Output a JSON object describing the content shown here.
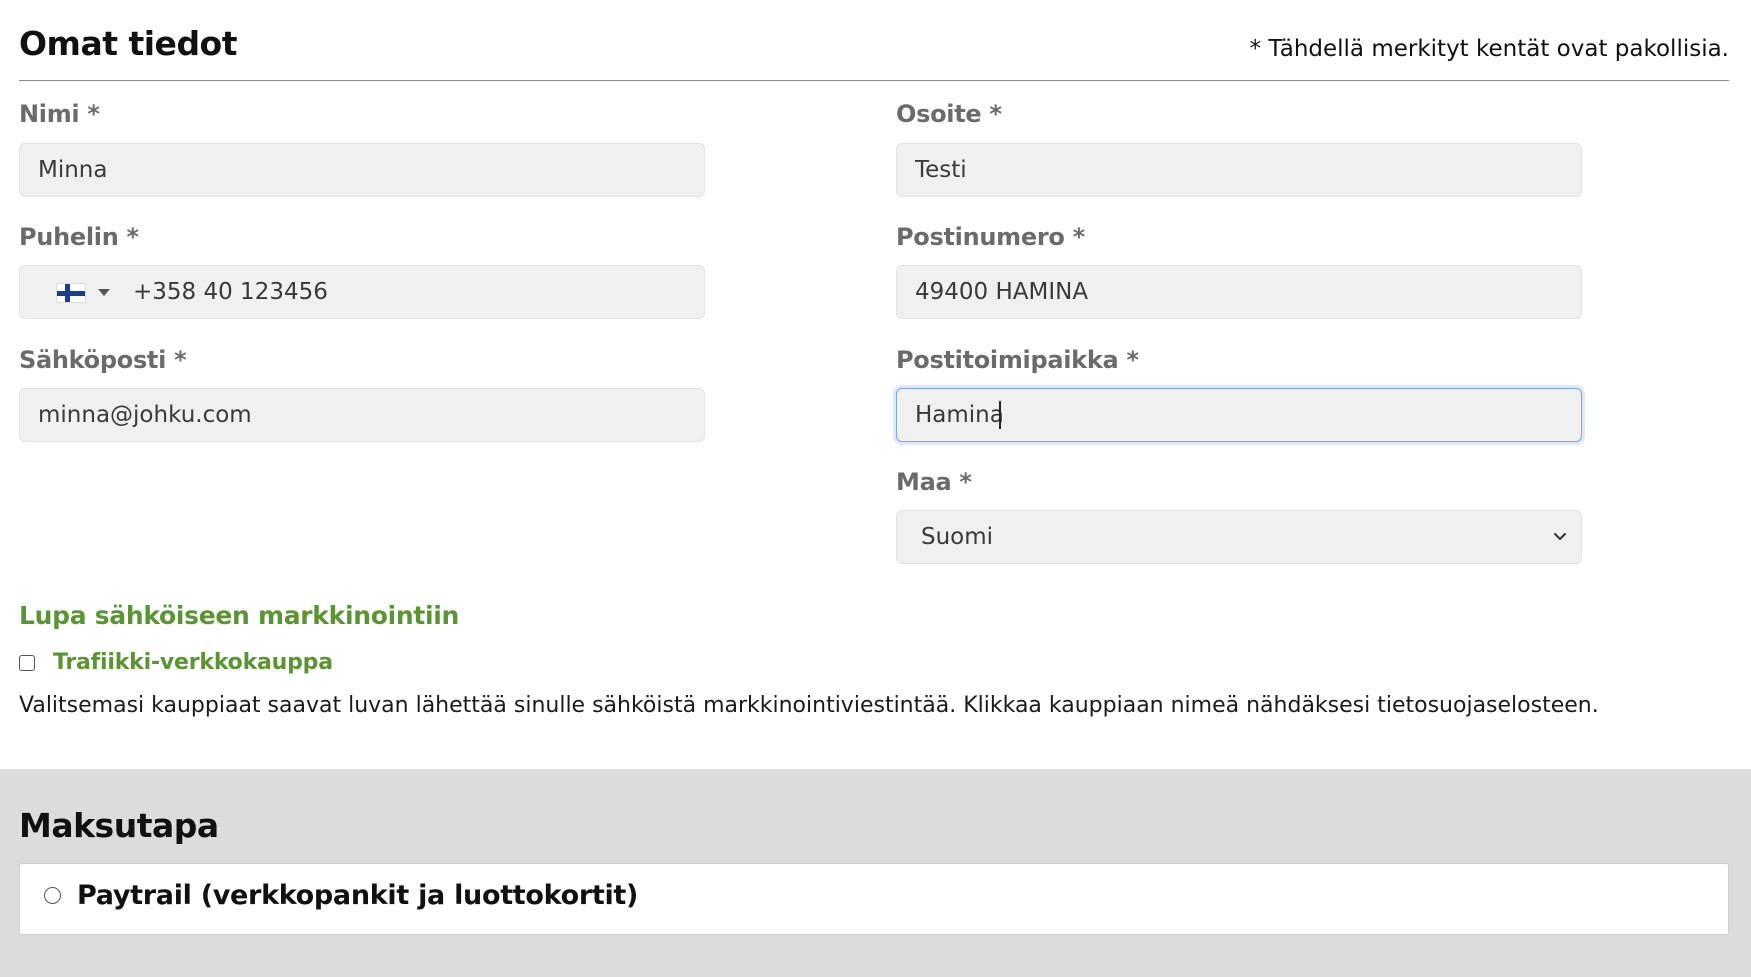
{
  "personal_info": {
    "title": "Omat tiedot",
    "required_note": "* Tähdellä merkityt kentät ovat pakollisia.",
    "fields": {
      "name": {
        "label": "Nimi *",
        "value": "Minna"
      },
      "phone": {
        "label": "Puhelin *",
        "value": "+358 40 123456",
        "country_flag": "finland-flag-icon"
      },
      "email": {
        "label": "Sähköposti *",
        "value": "minna@johku.com"
      },
      "address": {
        "label": "Osoite *",
        "value": "Testi"
      },
      "postal_code": {
        "label": "Postinumero *",
        "value": "49400 HAMINA"
      },
      "city": {
        "label": "Postitoimipaikka *",
        "value": "Hamina"
      },
      "country": {
        "label": "Maa *",
        "value": "Suomi"
      }
    }
  },
  "marketing": {
    "title": "Lupa sähköiseen markkinointiin",
    "checkbox_label": "Trafiikki-verkkokauppa",
    "checked": false,
    "description": "Valitsemasi kauppiaat saavat luvan lähettää sinulle sähköistä markkinointiviestintää. Klikkaa kauppiaan nimeä nähdäksesi tietosuojaselosteen."
  },
  "payment": {
    "title": "Maksutapa",
    "option_label": "Paytrail (verkkopankit ja luottokortit)",
    "selected": false
  },
  "colors": {
    "accent_green": "#5a9433",
    "focus_blue": "#78a8e8",
    "label_gray": "#6b6b6b",
    "payment_bg": "#dcdcdc"
  }
}
